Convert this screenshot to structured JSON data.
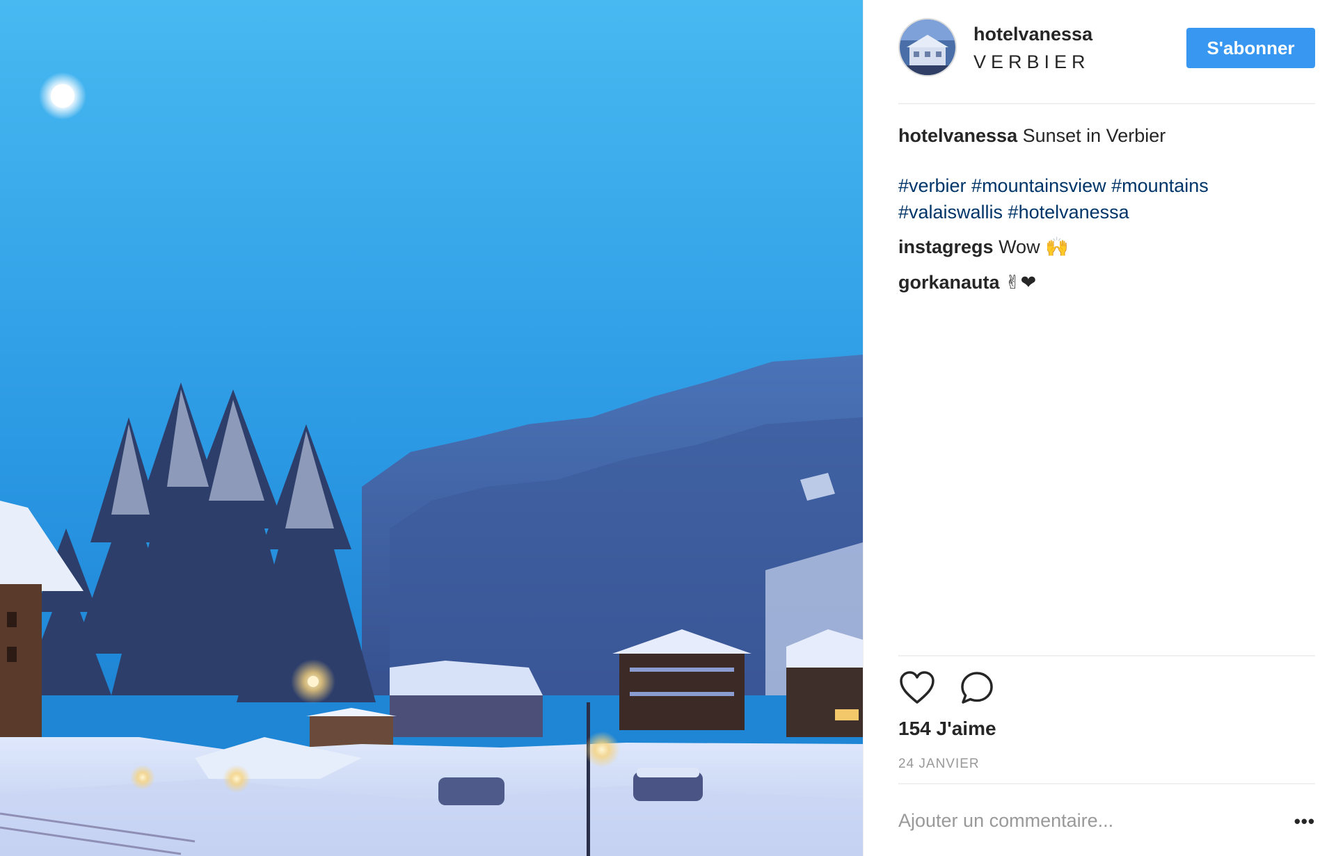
{
  "post": {
    "username": "hotelvanessa",
    "location": "VERBIER",
    "follow_label": "S'abonner",
    "caption": {
      "username": "hotelvanessa",
      "text": "Sunset in Verbier",
      "hashtags_line1": "#verbier #mountainsview #mountains",
      "hashtags_line2": "#valaiswallis #hotelvanessa"
    },
    "comments": [
      {
        "username": "instagregs",
        "text": "Wow",
        "emoji": "🙌"
      },
      {
        "username": "gorkanauta",
        "text": "",
        "emoji": "✌❤"
      }
    ],
    "likes": "154 J'aime",
    "date": "24 JANVIER",
    "comment_placeholder": "Ajouter un commentaire...",
    "more_label": "•••"
  },
  "icons": {
    "like": "heart-icon",
    "comment": "comment-bubble-icon",
    "more": "ellipsis-icon"
  },
  "colors": {
    "accent": "#3897f0",
    "hashtag": "#003569",
    "sky_top": "#47b8f0",
    "sky_bottom": "#1c7dd0"
  }
}
